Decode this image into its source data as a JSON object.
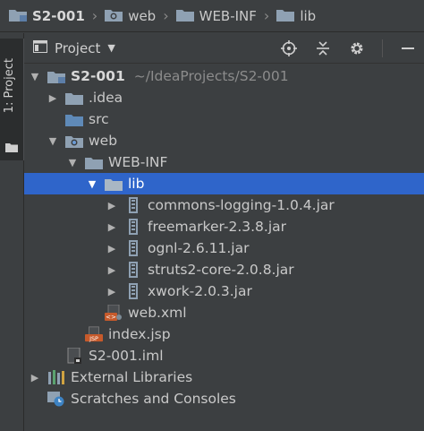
{
  "breadcrumb": [
    {
      "label": "S2-001",
      "icon": "module-folder-icon"
    },
    {
      "label": "web",
      "icon": "web-folder-icon"
    },
    {
      "label": "WEB-INF",
      "icon": "folder-icon"
    },
    {
      "label": "lib",
      "icon": "folder-icon"
    }
  ],
  "toolwindow": {
    "tab_label": "1: Project"
  },
  "panel": {
    "title": "Project"
  },
  "tree": {
    "root": {
      "label": "S2-001",
      "path": "~/IdeaProjects/S2-001"
    },
    "idea": {
      "label": ".idea"
    },
    "src": {
      "label": "src"
    },
    "web": {
      "label": "web"
    },
    "webinf": {
      "label": "WEB-INF"
    },
    "lib": {
      "label": "lib"
    },
    "jars": [
      {
        "label": "commons-logging-1.0.4.jar"
      },
      {
        "label": "freemarker-2.3.8.jar"
      },
      {
        "label": "ognl-2.6.11.jar"
      },
      {
        "label": "struts2-core-2.0.8.jar"
      },
      {
        "label": "xwork-2.0.3.jar"
      }
    ],
    "webxml": {
      "label": "web.xml"
    },
    "indexjsp": {
      "label": "index.jsp"
    },
    "iml": {
      "label": "S2-001.iml"
    },
    "external": {
      "label": "External Libraries"
    },
    "scratches": {
      "label": "Scratches and Consoles"
    }
  },
  "colors": {
    "selection": "#2f65ca",
    "background": "#3c3f41",
    "folder": "#8a9aa8"
  }
}
